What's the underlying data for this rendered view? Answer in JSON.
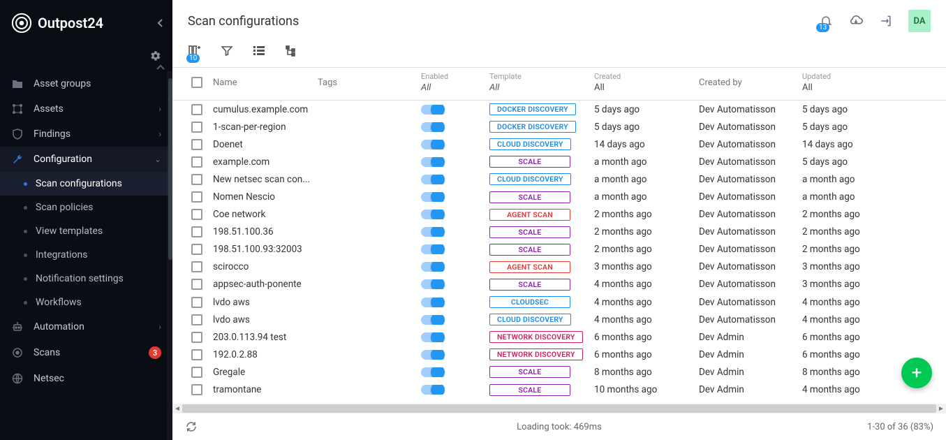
{
  "brand": "Outpost24",
  "page_title": "Scan configurations",
  "top": {
    "notif_count": "13",
    "avatar": "DA"
  },
  "toolbar": {
    "column_badge": "10"
  },
  "sidebar": {
    "items": [
      {
        "label": "Asset groups",
        "icon": "folder-icon",
        "expandable": false
      },
      {
        "label": "Assets",
        "icon": "nodes-icon",
        "expandable": true
      },
      {
        "label": "Findings",
        "icon": "shield-icon",
        "expandable": true
      },
      {
        "label": "Configuration",
        "icon": "wrench-icon",
        "expandable": true,
        "active": true
      },
      {
        "label": "Automation",
        "icon": "robot-icon",
        "expandable": true
      },
      {
        "label": "Scans",
        "icon": "target-icon",
        "expandable": false,
        "badge": "3"
      },
      {
        "label": "Netsec",
        "icon": "globe-icon",
        "expandable": false
      }
    ],
    "config_children": [
      {
        "label": "Scan configurations",
        "selected": true
      },
      {
        "label": "Scan policies"
      },
      {
        "label": "View templates"
      },
      {
        "label": "Integrations"
      },
      {
        "label": "Notification settings"
      },
      {
        "label": "Workflows"
      }
    ]
  },
  "columns": {
    "name": "Name",
    "tags": "Tags",
    "enabled_small": "Enabled",
    "enabled_main": "All",
    "template_small": "Template",
    "template_main": "All",
    "created_small": "Created",
    "created_main": "All",
    "createdby": "Created by",
    "updated_small": "Updated",
    "updated_main": "All"
  },
  "rows": [
    {
      "name": "cumulus.example.com",
      "template": "DOCKER DISCOVERY",
      "tpl_class": "tpl-docker",
      "created": "5 days ago",
      "created_by": "Dev Automatisson",
      "updated": "5 days ago"
    },
    {
      "name": "1-scan-per-region",
      "template": "DOCKER DISCOVERY",
      "tpl_class": "tpl-docker",
      "created": "5 days ago",
      "created_by": "Dev Automatisson",
      "updated": "5 days ago"
    },
    {
      "name": "Doenet",
      "template": "CLOUD DISCOVERY",
      "tpl_class": "tpl-cloud",
      "created": "14 days ago",
      "created_by": "Dev Automatisson",
      "updated": "14 days ago"
    },
    {
      "name": "example.com",
      "template": "SCALE",
      "tpl_class": "tpl-scale",
      "created": "a month ago",
      "created_by": "Dev Automatisson",
      "updated": "5 days ago"
    },
    {
      "name": "New netsec scan con...",
      "template": "CLOUD DISCOVERY",
      "tpl_class": "tpl-cloud",
      "created": "a month ago",
      "created_by": "Dev Automatisson",
      "updated": "a month ago"
    },
    {
      "name": "Nomen Nescio",
      "template": "SCALE",
      "tpl_class": "tpl-scale",
      "created": "a month ago",
      "created_by": "Dev Automatisson",
      "updated": "a month ago"
    },
    {
      "name": "Coe network",
      "template": "AGENT SCAN",
      "tpl_class": "tpl-agent",
      "created": "2 months ago",
      "created_by": "Dev Automatisson",
      "updated": "2 months ago"
    },
    {
      "name": "198.51.100.36",
      "template": "SCALE",
      "tpl_class": "tpl-scale",
      "created": "2 months ago",
      "created_by": "Dev Automatisson",
      "updated": "2 months ago"
    },
    {
      "name": "198.51.100.93:32003",
      "template": "SCALE",
      "tpl_class": "tpl-scale",
      "created": "2 months ago",
      "created_by": "Dev Automatisson",
      "updated": "2 months ago"
    },
    {
      "name": "scirocco",
      "template": "AGENT SCAN",
      "tpl_class": "tpl-agent",
      "created": "3 months ago",
      "created_by": "Dev Automatisson",
      "updated": "3 months ago"
    },
    {
      "name": "appsec-auth-ponente",
      "template": "SCALE",
      "tpl_class": "tpl-scale",
      "created": "4 months ago",
      "created_by": "Dev Automatisson",
      "updated": "3 months ago"
    },
    {
      "name": "lvdo aws",
      "template": "CLOUDSEC",
      "tpl_class": "tpl-cloudsec",
      "created": "4 months ago",
      "created_by": "Dev Automatisson",
      "updated": "4 months ago"
    },
    {
      "name": "lvdo aws",
      "template": "CLOUD DISCOVERY",
      "tpl_class": "tpl-cloud",
      "created": "4 months ago",
      "created_by": "Dev Automatisson",
      "updated": "4 months ago"
    },
    {
      "name": "203.0.113.94 test",
      "template": "NETWORK DISCOVERY",
      "tpl_class": "tpl-network",
      "created": "6 months ago",
      "created_by": "Dev Admin",
      "updated": "6 months ago"
    },
    {
      "name": "192.0.2.88",
      "template": "NETWORK DISCOVERY",
      "tpl_class": "tpl-network",
      "created": "6 months ago",
      "created_by": "Dev Admin",
      "updated": "6 months ago"
    },
    {
      "name": "Gregale",
      "template": "SCALE",
      "tpl_class": "tpl-scale",
      "created": "8 months ago",
      "created_by": "Dev Admin",
      "updated": "8 months ago"
    },
    {
      "name": "tramontane",
      "template": "SCALE",
      "tpl_class": "tpl-scale",
      "created": "10 months ago",
      "created_by": "Dev Admin",
      "updated": "4 months ago"
    }
  ],
  "footer": {
    "loading": "Loading took: 469ms",
    "count": "1-30 of 36 (83%)"
  }
}
